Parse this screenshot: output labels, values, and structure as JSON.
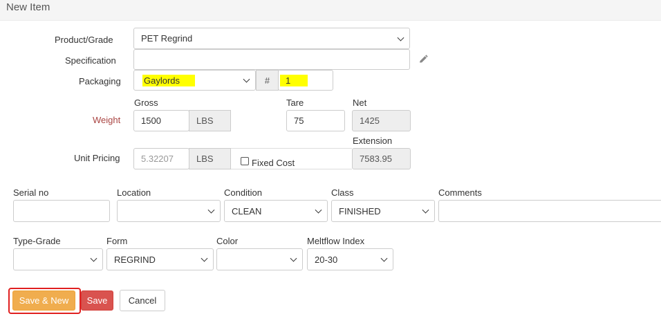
{
  "header": {
    "title": "New Item"
  },
  "product": {
    "label": "Product/Grade",
    "value": "PET Regrind"
  },
  "specification": {
    "label": "Specification",
    "value": "",
    "edit_icon": "pencil-icon"
  },
  "packaging": {
    "label": "Packaging",
    "value": "Gaylords",
    "count_prefix": "#",
    "count": "1"
  },
  "weight": {
    "label": "Weight",
    "gross_label": "Gross",
    "gross": "1500",
    "gross_unit": "LBS",
    "tare_label": "Tare",
    "tare": "75",
    "net_label": "Net",
    "net": "1425"
  },
  "pricing": {
    "label": "Unit Pricing",
    "value": "5.32207",
    "unit": "LBS",
    "fixed_cost_label": "Fixed Cost",
    "fixed_cost_checked": false,
    "extension_label": "Extension",
    "extension": "7583.95"
  },
  "row1": {
    "serial_label": "Serial no",
    "serial": "",
    "location_label": "Location",
    "location": "",
    "condition_label": "Condition",
    "condition": "CLEAN",
    "class_label": "Class",
    "class": "FINISHED",
    "comments_label": "Comments",
    "comments": ""
  },
  "row2": {
    "type_grade_label": "Type-Grade",
    "type_grade": "",
    "form_label": "Form",
    "form": "REGRIND",
    "color_label": "Color",
    "color": "",
    "meltflow_label": "Meltflow Index",
    "meltflow": "20-30"
  },
  "buttons": {
    "save_new": "Save & New",
    "save": "Save",
    "cancel": "Cancel"
  },
  "colors": {
    "highlight": "#ffff00",
    "warning": "#f0ad4e",
    "danger": "#d9534f",
    "weight_label": "#a94442",
    "focus_ring": "#e02020"
  }
}
